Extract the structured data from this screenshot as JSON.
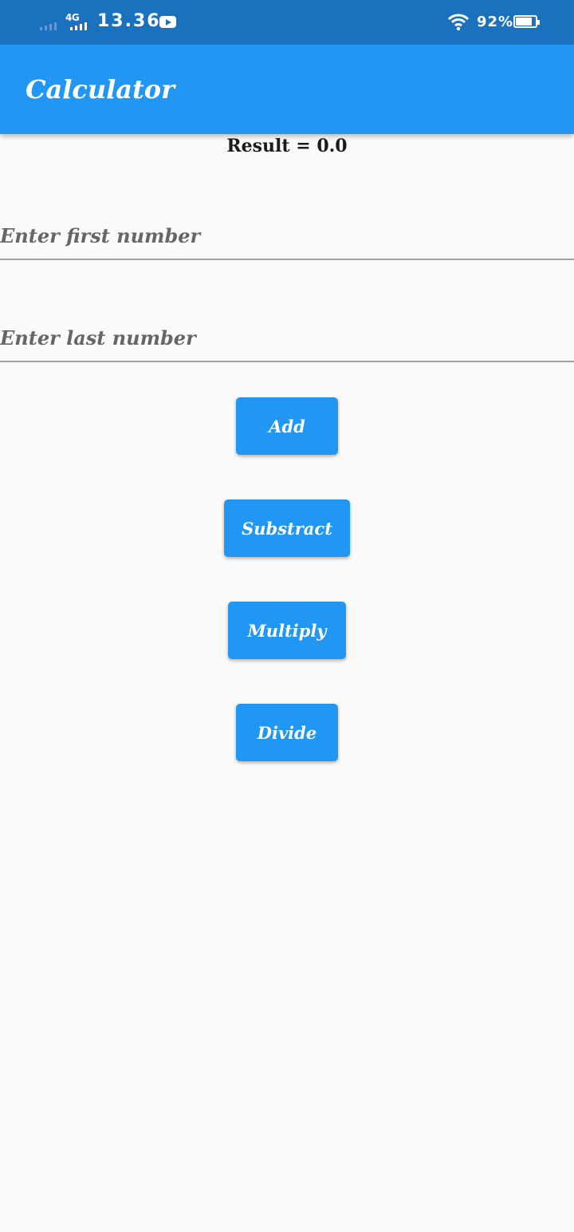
{
  "status_bar": {
    "network": "4G",
    "time": "13.36",
    "battery_percent": "92%",
    "battery_level": 0.92,
    "icons": [
      "signal-icon",
      "youtube-icon",
      "wifi-icon",
      "battery-icon"
    ]
  },
  "app_bar": {
    "title": "Calculator"
  },
  "result": {
    "label": "Result",
    "separator": " = ",
    "value": "0.0"
  },
  "inputs": {
    "first": {
      "value": "",
      "placeholder": "Enter first number"
    },
    "last": {
      "value": "",
      "placeholder": "Enter last number"
    }
  },
  "buttons": {
    "add": "Add",
    "subtract": "Substract",
    "multiply": "Multiply",
    "divide": "Divide"
  },
  "colors": {
    "status_bar": "#1a72bf",
    "primary": "#2196f3",
    "background": "#fafafa",
    "on_primary": "#ffffff",
    "text": "#1c1c1c",
    "hint": "#666666"
  }
}
